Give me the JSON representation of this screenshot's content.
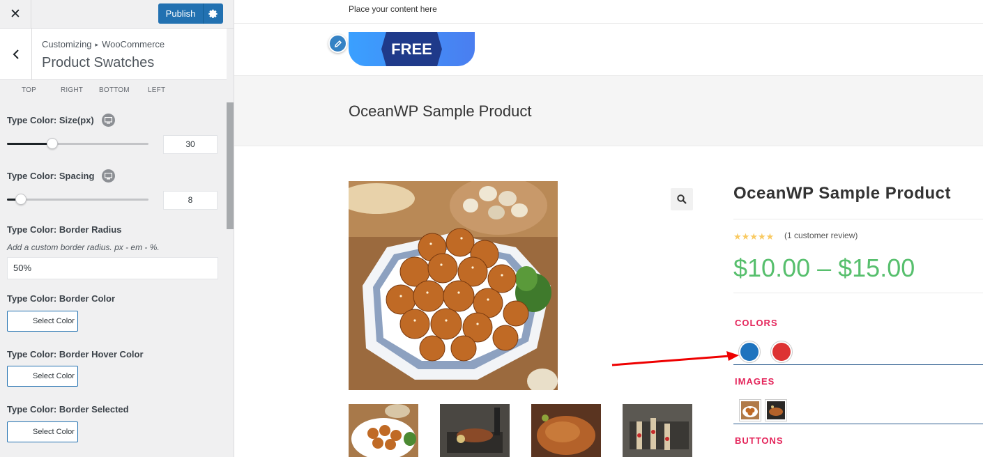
{
  "customizer": {
    "publish_label": "Publish",
    "breadcrumb": {
      "root": "Customizing",
      "sep": "▸",
      "section": "WooCommerce"
    },
    "section_title": "Product Swatches",
    "dimensions": [
      "TOP",
      "RIGHT",
      "BOTTOM",
      "LEFT"
    ],
    "controls": {
      "size": {
        "label": "Type Color: Size(px)",
        "value": "30",
        "slider_fraction": 0.32
      },
      "spacing": {
        "label": "Type Color: Spacing",
        "value": "8",
        "slider_fraction": 0.1
      },
      "border_radius": {
        "label": "Type Color: Border Radius",
        "description": "Add a custom border radius. px - em - %.",
        "value": "50%"
      },
      "border_color": {
        "label": "Type Color: Border Color",
        "button": "Select Color"
      },
      "border_hover_color": {
        "label": "Type Color: Border Hover Color",
        "button": "Select Color"
      },
      "border_selected": {
        "label": "Type Color: Border Selected",
        "button": "Select Color"
      }
    }
  },
  "preview": {
    "topbar_text": "Place your content here",
    "badge_text": "FREE",
    "page_title": "OceanWP Sample Product",
    "product": {
      "title": "OceanWP Sample Product",
      "rating": 5,
      "review_text": "(1 customer review)",
      "price": "$10.00 – $15.00",
      "attributes": {
        "colors_label": "COLORS",
        "colors": [
          "#1e73be",
          "#dd3333"
        ],
        "images_label": "IMAGES",
        "buttons_label": "BUTTONS"
      }
    }
  },
  "colors": {
    "accent": "#2271b1",
    "price": "#57bf6d",
    "attr_label": "#e4245a",
    "arrow": "#ee0000"
  }
}
